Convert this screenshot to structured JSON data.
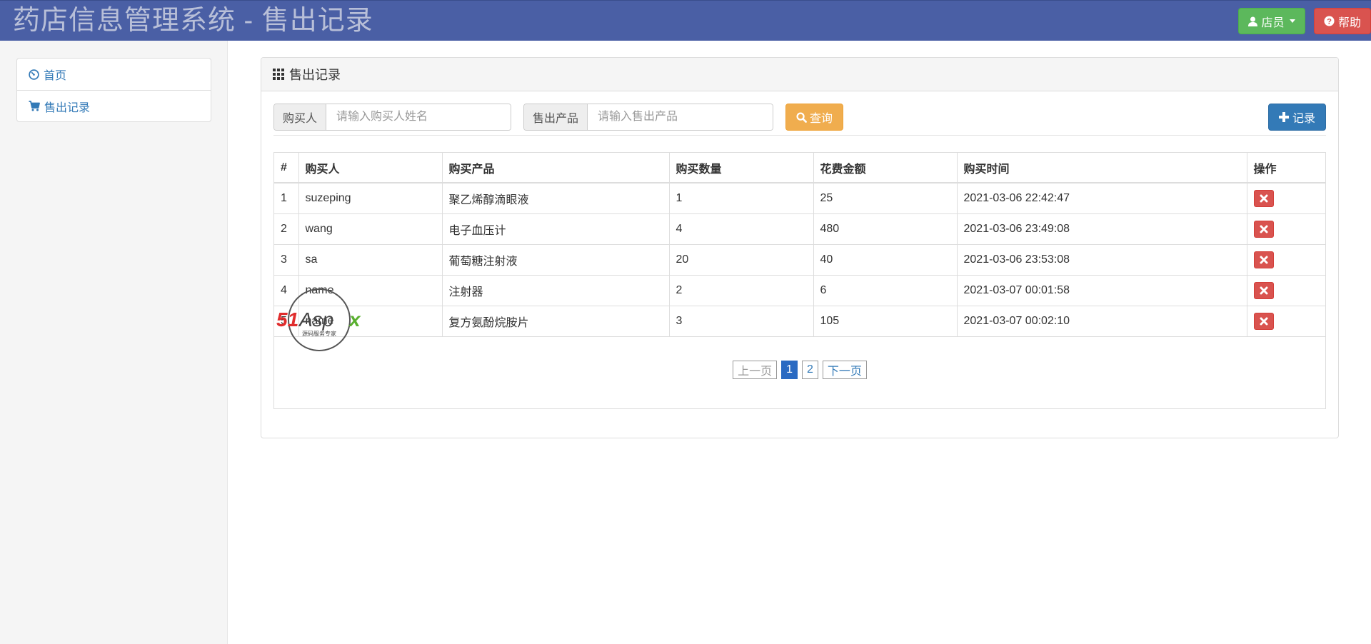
{
  "header": {
    "title": "药店信息管理系统 - 售出记录",
    "user_button": "店员",
    "help_button": "帮助"
  },
  "sidebar": {
    "items": [
      {
        "label": "首页",
        "icon": "dashboard-icon"
      },
      {
        "label": "售出记录",
        "icon": "cart-icon"
      }
    ]
  },
  "panel": {
    "title": "售出记录",
    "search": {
      "buyer_label": "购买人",
      "buyer_placeholder": "请输入购买人姓名",
      "product_label": "售出产品",
      "product_placeholder": "请输入售出产品",
      "query_button": "查询",
      "record_button": "记录"
    },
    "table": {
      "columns": [
        "#",
        "购买人",
        "购买产品",
        "购买数量",
        "花费金额",
        "购买时间",
        "操作"
      ],
      "rows": [
        [
          "1",
          "suzeping",
          "聚乙烯醇滴眼液",
          "1",
          "25",
          "2021-03-06 22:42:47"
        ],
        [
          "2",
          "wang",
          "电子血压计",
          "4",
          "480",
          "2021-03-06 23:49:08"
        ],
        [
          "3",
          "sa",
          "葡萄糖注射液",
          "20",
          "40",
          "2021-03-06 23:53:08"
        ],
        [
          "4",
          "name",
          "注射器",
          "2",
          "6",
          "2021-03-07 00:01:58"
        ],
        [
          "5",
          "name",
          "复方氨酚烷胺片",
          "3",
          "105",
          "2021-03-07 00:02:10"
        ]
      ]
    },
    "pager": {
      "prev": "上一页",
      "pages": [
        "1",
        "2"
      ],
      "next": "下一页",
      "current": "1"
    }
  },
  "watermark": {
    "brand": "51Aspx",
    "tagline": "源码服务专家"
  },
  "colors": {
    "header_bg": "#4a5fa5",
    "success": "#5cb85c",
    "danger": "#d9534f",
    "warning": "#f0ad4e",
    "primary": "#337ab7"
  }
}
